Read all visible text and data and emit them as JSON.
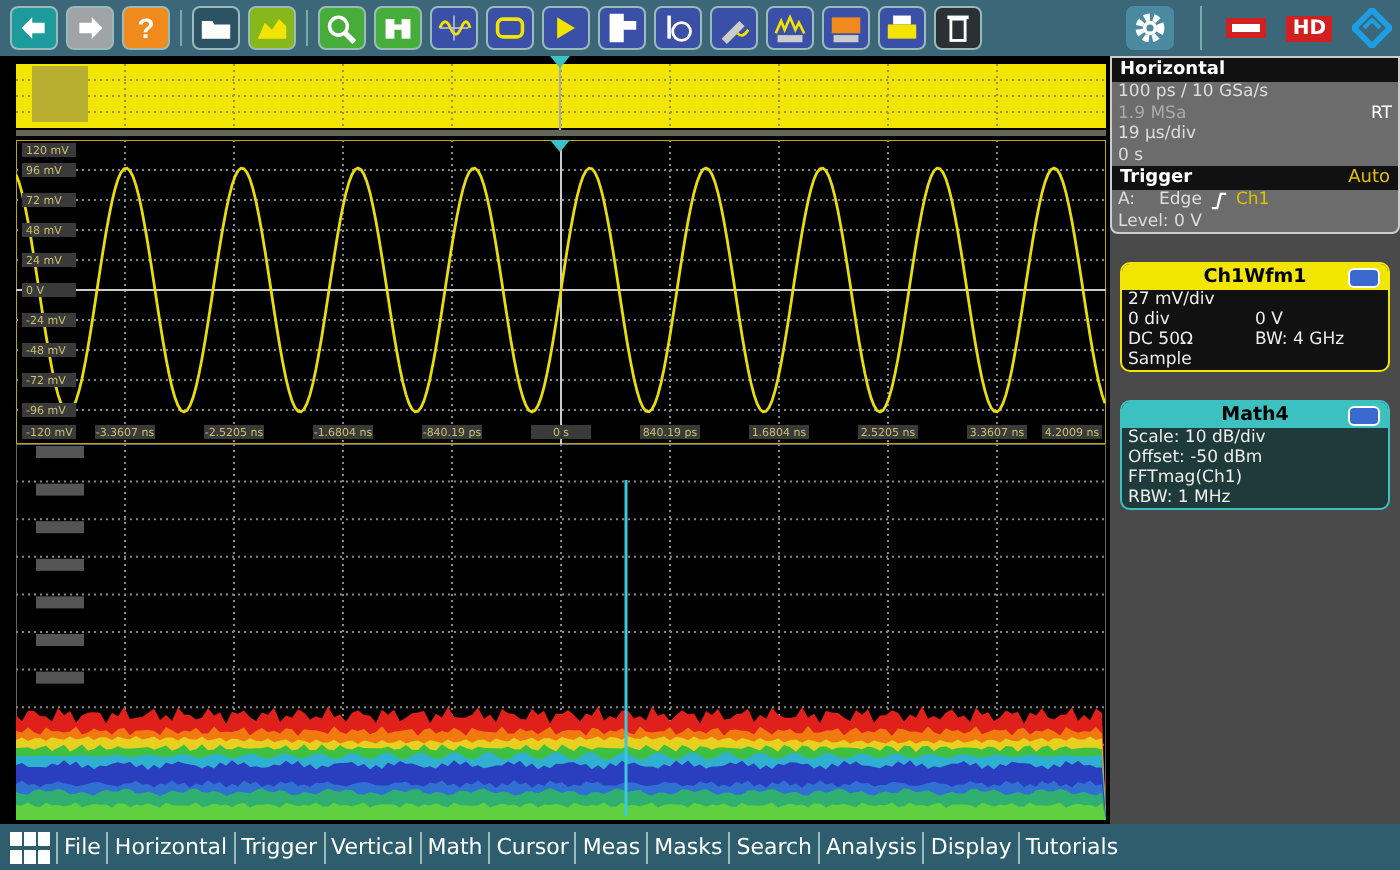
{
  "toolbar": {
    "help_glyph": "?",
    "hd_badge": "HD"
  },
  "waveform": {
    "y_labels": [
      "120 mV",
      "96 mV",
      "72 mV",
      "48 mV",
      "24 mV",
      "0 V",
      "-24 mV",
      "-48 mV",
      "-72 mV",
      "-96 mV",
      "-120 mV"
    ],
    "x_labels": [
      "-3.3607 ns",
      "-2.5205 ns",
      "-1.6804 ns",
      "-840.19 ps",
      "0 s",
      "840.19 ps",
      "1.6804 ns",
      "2.5205 ns",
      "3.3607 ns",
      "4.2009 ns"
    ]
  },
  "horizontal": {
    "title": "Horizontal",
    "mode": "RT",
    "lines": [
      {
        "text": "100 ps / 10 GSa/s",
        "dimmed": false
      },
      {
        "text": "1.9 MSa",
        "dimmed": true
      },
      {
        "text": "19 µs/div",
        "dimmed": false
      },
      {
        "text": "0 s",
        "dimmed": false
      }
    ]
  },
  "trigger": {
    "title": "Trigger",
    "mode": "Auto",
    "source": "A:",
    "type": "Edge",
    "channel": "Ch1",
    "level": "Level: 0 V"
  },
  "cards": [
    {
      "kind": "waveform",
      "title": "Ch1Wfm1",
      "color": "#f2e600",
      "rows": [
        [
          "27 mV/div"
        ],
        [
          "0 div",
          "0 V"
        ],
        [
          "DC 50Ω",
          "BW: 4 GHz"
        ],
        [
          "Sample"
        ]
      ]
    },
    {
      "kind": "math",
      "title": "Math4",
      "color": "#3cc0c0",
      "rows": [
        [
          "Scale:  10 dB/div"
        ],
        [
          "Offset: -50 dBm"
        ],
        [
          "FFTmag(Ch1)"
        ],
        [
          "RBW:  1 MHz"
        ]
      ]
    }
  ],
  "menu": [
    "File",
    "Horizontal",
    "Trigger",
    "Vertical",
    "Math",
    "Cursor",
    "Meas",
    "Masks",
    "Search",
    "Analysis",
    "Display",
    "Tutorials"
  ]
}
